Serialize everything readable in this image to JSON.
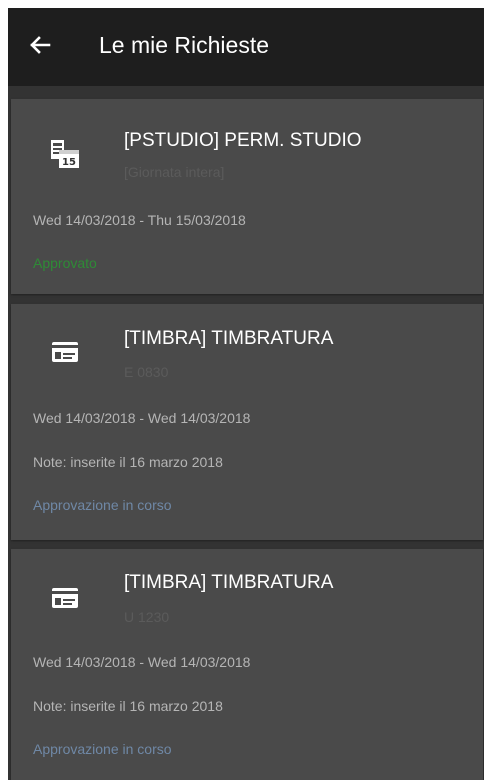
{
  "appbar": {
    "title": "Le mie Richieste",
    "back_icon": "arrow-left-icon"
  },
  "colors": {
    "appbar_bg": "#1e1e1e",
    "screen_bg": "#333333",
    "card_bg": "#4a4a4a",
    "approved": "#2e8b36",
    "pending": "#6f88a6"
  },
  "requests": [
    {
      "icon": "calendar-icon",
      "title": "[PSTUDIO] PERM. STUDIO",
      "subtitle": "[Giornata intera]",
      "dates": "Wed 14/03/2018 - Thu 15/03/2018",
      "note": "",
      "status": "Approvato"
    },
    {
      "icon": "badge-card-icon",
      "title": "[TIMBRA] TIMBRATURA",
      "subtitle": "E 0830",
      "dates": "Wed 14/03/2018 - Wed 14/03/2018",
      "note": "Note: inserite il 16 marzo 2018",
      "status": "Approvazione in corso"
    },
    {
      "icon": "badge-card-icon",
      "title": "[TIMBRA] TIMBRATURA",
      "subtitle": "U 1230",
      "dates": "Wed 14/03/2018 - Wed 14/03/2018",
      "note": "Note: inserite il 16 marzo 2018",
      "status": "Approvazione in corso"
    }
  ]
}
